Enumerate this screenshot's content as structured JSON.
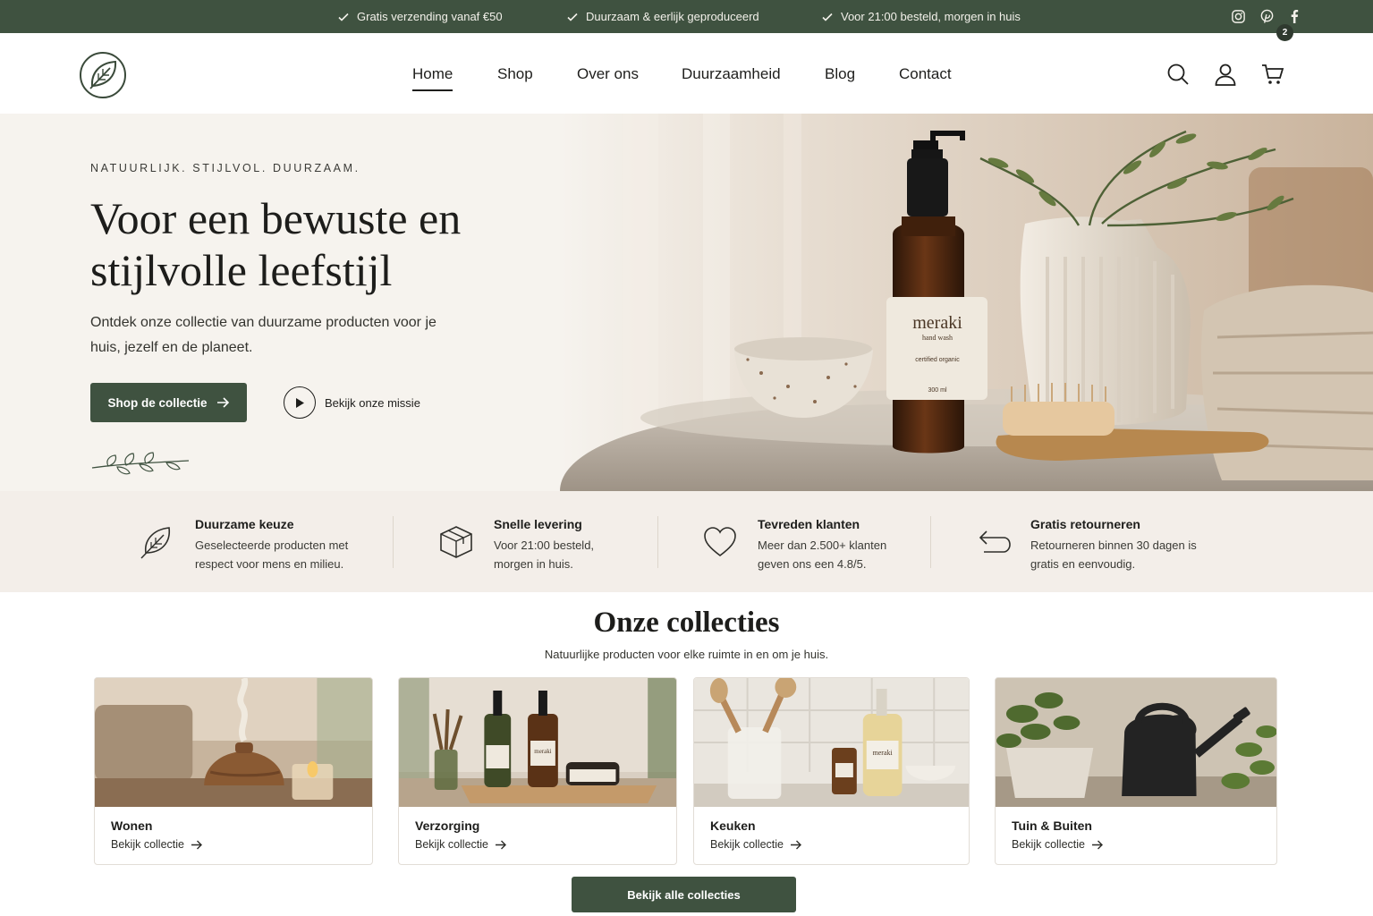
{
  "topbar": {
    "usps": [
      {
        "text": "Gratis verzending vanaf €50",
        "icon": "check-icon"
      },
      {
        "text": "Duurzaam & eerlijk geproduceerd",
        "icon": "check-icon"
      },
      {
        "text": "Voor 21:00 besteld, morgen in huis",
        "icon": "check-icon"
      }
    ],
    "social": [
      "instagram-icon",
      "pinterest-icon",
      "facebook-icon"
    ]
  },
  "header": {
    "logo": "leaf-logo",
    "nav": [
      "Home",
      "Shop",
      "Over ons",
      "Duurzaamheid",
      "Blog",
      "Contact"
    ],
    "active_nav": "Home",
    "cart_count": "2"
  },
  "hero": {
    "eyebrow": "NATUURLIJK. STIJLVOL. DUURZAAM.",
    "title": "Voor een bewuste en stijlvolle leefstijl",
    "subtitle": "Ontdek onze collectie van duurzame producten voor je huis, jezelf en de planeet.",
    "primary_button": "Shop de collectie",
    "secondary_button": "Bekijk onze missie",
    "image_labels": {
      "brand": "meraki",
      "product": "hand wash",
      "cert": "certified organic",
      "volume": "300 ml"
    }
  },
  "features": [
    {
      "title": "Duurzame keuze",
      "text": "Geselecteerde producten met respect voor mens en milieu.",
      "icon": "leaf-icon"
    },
    {
      "title": "Snelle levering",
      "text": "Voor 21:00 besteld, morgen in huis.",
      "icon": "box-icon"
    },
    {
      "title": "Tevreden klanten",
      "text": "Meer dan 2.500+ klanten geven ons een 4.8/5.",
      "icon": "heart-icon"
    },
    {
      "title": "Gratis retourneren",
      "text": "Retourneren binnen 30 dagen is gratis en eenvoudig.",
      "icon": "return-icon"
    }
  ],
  "collections": {
    "title": "Onze collecties",
    "subtitle": "Natuurlijke producten voor elke ruimte in en om je huis.",
    "items": [
      {
        "name": "Wonen",
        "link": "Bekijk collectie"
      },
      {
        "name": "Verzorging",
        "link": "Bekijk collectie"
      },
      {
        "name": "Keuken",
        "link": "Bekijk collectie"
      },
      {
        "name": "Tuin & Buiten",
        "link": "Bekijk collectie"
      }
    ],
    "all_button": "Bekijk alle collecties"
  },
  "colors": {
    "brand_green": "#3f5240",
    "cream": "#f6f3ee",
    "feature_bg": "#f3eee9"
  }
}
